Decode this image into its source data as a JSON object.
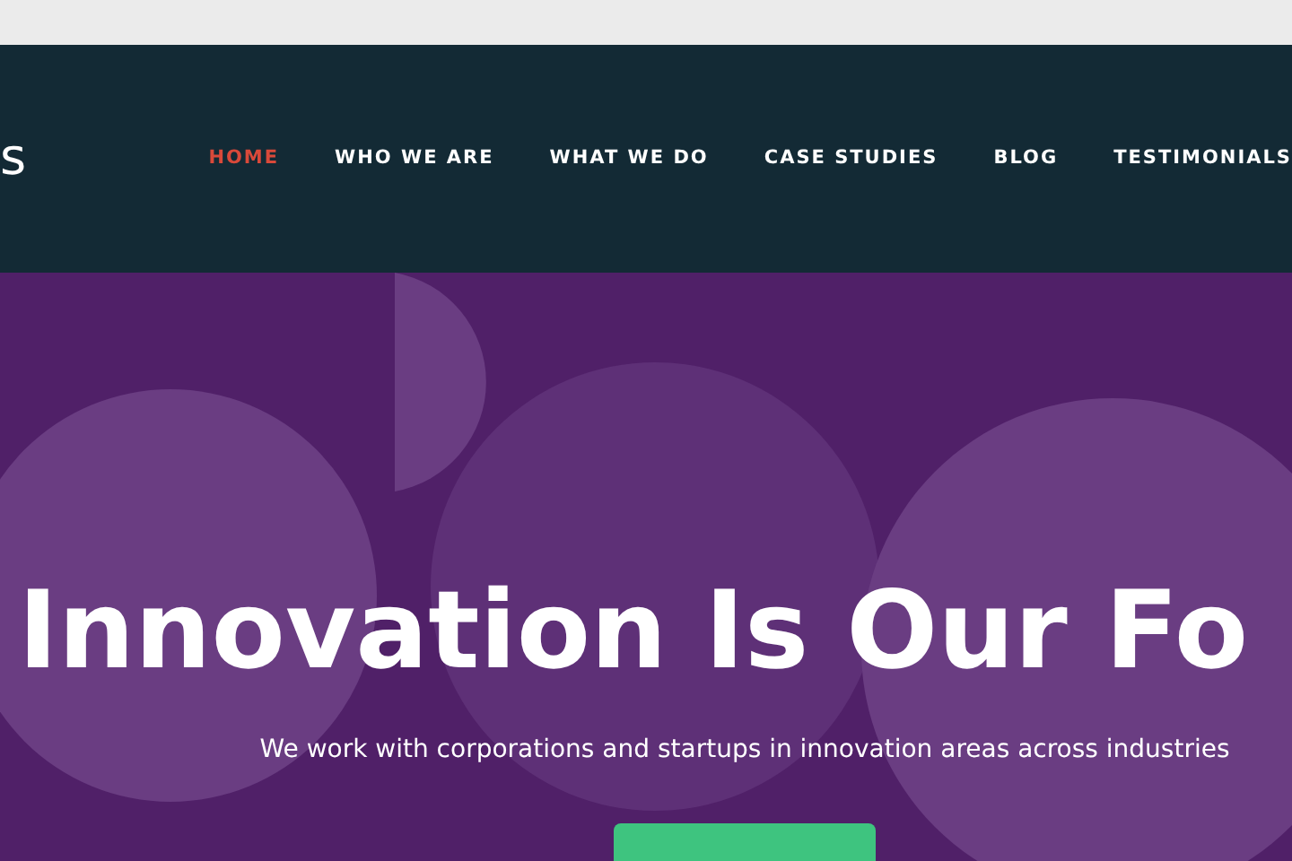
{
  "header": {
    "logo_text": "s",
    "nav": [
      {
        "label": "HOME",
        "selected": true
      },
      {
        "label": "WHO WE ARE",
        "selected": false
      },
      {
        "label": "WHAT WE DO",
        "selected": false
      },
      {
        "label": "CASE STUDIES",
        "selected": false
      },
      {
        "label": "BLOG",
        "selected": false
      },
      {
        "label": "TESTIMONIALS",
        "selected": false
      }
    ]
  },
  "hero": {
    "heading": "Innovation Is Our Fo",
    "subtitle": "We work with corporations and startups in innovation areas across industries"
  }
}
